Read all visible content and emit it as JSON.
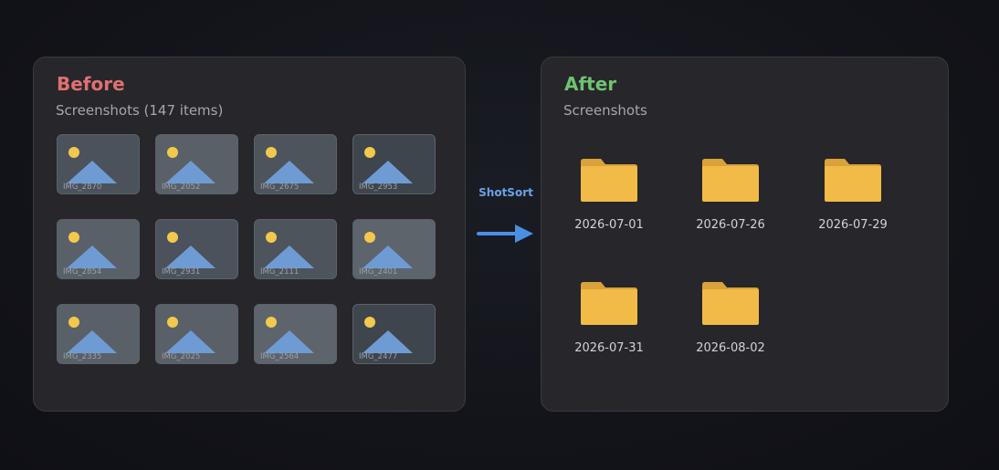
{
  "before": {
    "title": "Before",
    "subtitle": "Screenshots (147 items)",
    "files": [
      {
        "label": "IMG_2870",
        "bg": "#4b525b"
      },
      {
        "label": "IMG_2052",
        "bg": "#5a6068"
      },
      {
        "label": "IMG_2675",
        "bg": "#4d545c"
      },
      {
        "label": "IMG_2953",
        "bg": "#3f454d"
      },
      {
        "label": "IMG_2854",
        "bg": "#5a6068"
      },
      {
        "label": "IMG_2931",
        "bg": "#4b525b"
      },
      {
        "label": "IMG_2111",
        "bg": "#4d545c"
      },
      {
        "label": "IMG_2401",
        "bg": "#5e646c"
      },
      {
        "label": "IMG_2335",
        "bg": "#5a6068"
      },
      {
        "label": "IMG_2025",
        "bg": "#5a6068"
      },
      {
        "label": "IMG_2564",
        "bg": "#5e646c"
      },
      {
        "label": "IMG_2477",
        "bg": "#3f454d"
      }
    ]
  },
  "transition": {
    "label": "ShotSort",
    "icon": "right-arrow-icon",
    "color": "#4a90e2"
  },
  "after": {
    "title": "After",
    "subtitle": "Screenshots",
    "folders": [
      {
        "label": "2026-07-01"
      },
      {
        "label": "2026-07-26"
      },
      {
        "label": "2026-07-29"
      },
      {
        "label": "2026-07-31"
      },
      {
        "label": "2026-08-02"
      }
    ]
  },
  "colors": {
    "before_title": "#e07070",
    "after_title": "#6fc36f",
    "folder": "#f2bb47",
    "folder_tab": "#d9a23a",
    "sun": "#f2c94c",
    "mountain": "#6f9bd4"
  }
}
